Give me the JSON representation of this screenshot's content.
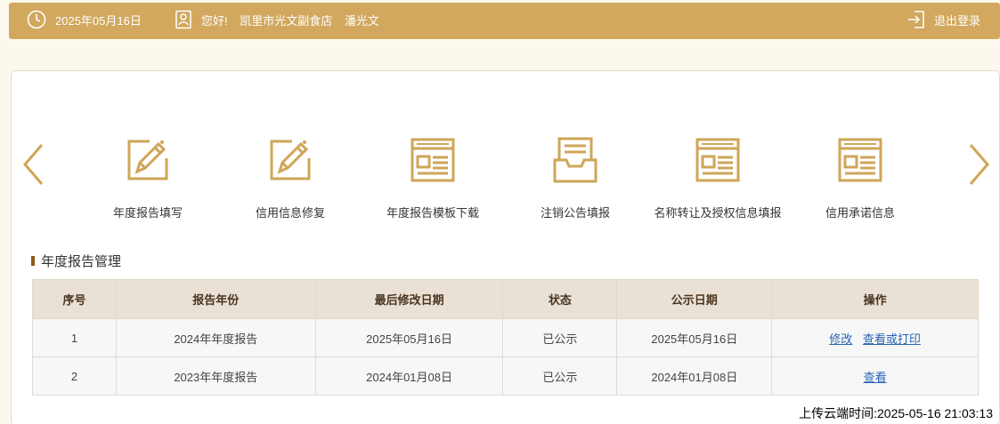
{
  "header": {
    "date": "2025年05月16日",
    "greeting": "您好!",
    "store_name": "凯里市光文副食店",
    "user_name": "潘光文",
    "logout_label": "退出登录"
  },
  "menu": {
    "items": [
      {
        "label": "年度报告填写",
        "icon": "edit-icon"
      },
      {
        "label": "信用信息修复",
        "icon": "edit-icon"
      },
      {
        "label": "年度报告模板下载",
        "icon": "form-document-icon"
      },
      {
        "label": "注销公告填报",
        "icon": "inbox-document-icon"
      },
      {
        "label": "名称转让及授权信息填报",
        "icon": "form-document-icon"
      },
      {
        "label": "信用承诺信息",
        "icon": "form-document-icon"
      }
    ]
  },
  "section": {
    "title": "年度报告管理"
  },
  "table": {
    "headers": [
      "序号",
      "报告年份",
      "最后修改日期",
      "状态",
      "公示日期",
      "操作"
    ],
    "rows": [
      {
        "no": "1",
        "year": "2024年年度报告",
        "modified": "2025年05月16日",
        "status": "已公示",
        "published": "2025年05月16日",
        "action_modify": "修改",
        "action_view": "查看或打印"
      },
      {
        "no": "2",
        "year": "2023年年度报告",
        "modified": "2024年01月08日",
        "status": "已公示",
        "published": "2024年01月08日",
        "action_view": "查看"
      }
    ]
  },
  "footer": {
    "upload_time": "上传云端时间:2025-05-16 21:03:13"
  },
  "colors": {
    "brand": "#d1a85e",
    "icon_gold": "#cfa658",
    "link": "#2a64b5"
  }
}
